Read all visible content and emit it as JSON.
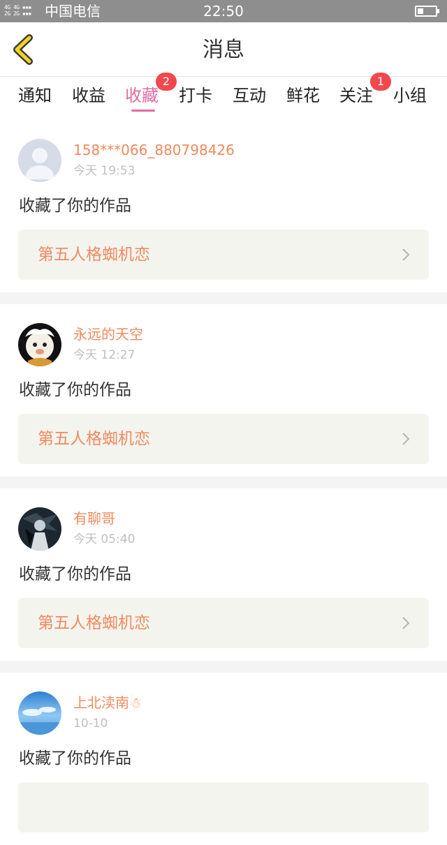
{
  "status_bar": {
    "signal_text": "4G 4G\n2G 2G",
    "carrier": "中国电信",
    "time": "22:50",
    "battery_level": 0.35
  },
  "header": {
    "title": "消息",
    "back_icon": "chevron-left-icon",
    "accent": "#f5d320"
  },
  "tabs": [
    {
      "label": "通知",
      "badge": ""
    },
    {
      "label": "收益",
      "badge": ""
    },
    {
      "label": "收藏",
      "badge": "2",
      "active": true
    },
    {
      "label": "打卡",
      "badge": ""
    },
    {
      "label": "互动",
      "badge": ""
    },
    {
      "label": "鲜花",
      "badge": ""
    },
    {
      "label": "关注",
      "badge": "1"
    },
    {
      "label": "小组",
      "badge": ""
    }
  ],
  "colors": {
    "tab_active": "#e36aa0",
    "badge": "#f2484b",
    "username": "#f08a5d",
    "work_bg": "#f4f4ef"
  },
  "items": [
    {
      "username": "158***066_880798426",
      "time": "今天 19:53",
      "action": "收藏了你的作品",
      "work_title": "第五人格蜘机恋"
    },
    {
      "username": "永远的天空",
      "time": "今天 12:27",
      "action": "收藏了你的作品",
      "work_title": "第五人格蜘机恋"
    },
    {
      "username": "有聊哥",
      "time": "今天 05:40",
      "action": "收藏了你的作品",
      "work_title": "第五人格蜘机恋"
    },
    {
      "username": "上北渎南☃",
      "time": "10-10",
      "action": "收藏了你的作品",
      "work_title": ""
    }
  ]
}
